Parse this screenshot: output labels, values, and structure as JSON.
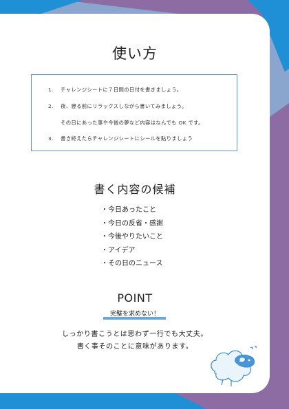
{
  "title": "使い方",
  "howto": {
    "steps": [
      {
        "num": "1.",
        "text": "チャレンジシートに７日間の日付を書きましょう。"
      },
      {
        "num": "2.",
        "text": "夜、寝る前にリラックスしながら書いてみましょう。"
      },
      {
        "num": "",
        "text": "その日にあった事や今後の夢など内容はなんでも OK です。"
      },
      {
        "num": "3.",
        "text": "書き終えたらチャレンジシートにシールを貼りましょう"
      }
    ]
  },
  "ideas": {
    "title": "書く内容の候補",
    "items": [
      "・今日あったこと",
      "・今日の反省・感謝",
      "・今後やりたいこと",
      "・アイデア",
      "・その日のニュース"
    ]
  },
  "point": {
    "title": "POINT",
    "subtitle": "完璧を求めない！",
    "lines": [
      "しっかり書こうとは思わず一行でも大丈夫。",
      "書く事そのことに意味があります。"
    ]
  },
  "colors": {
    "purple": "#8d6ba3",
    "light_blue": "#8aa6cf",
    "bright_blue": "#1f8fd6",
    "box_border": "#5b8fd0",
    "underline": "#6ca5d6"
  },
  "icons": [
    "sheep-illustration"
  ]
}
